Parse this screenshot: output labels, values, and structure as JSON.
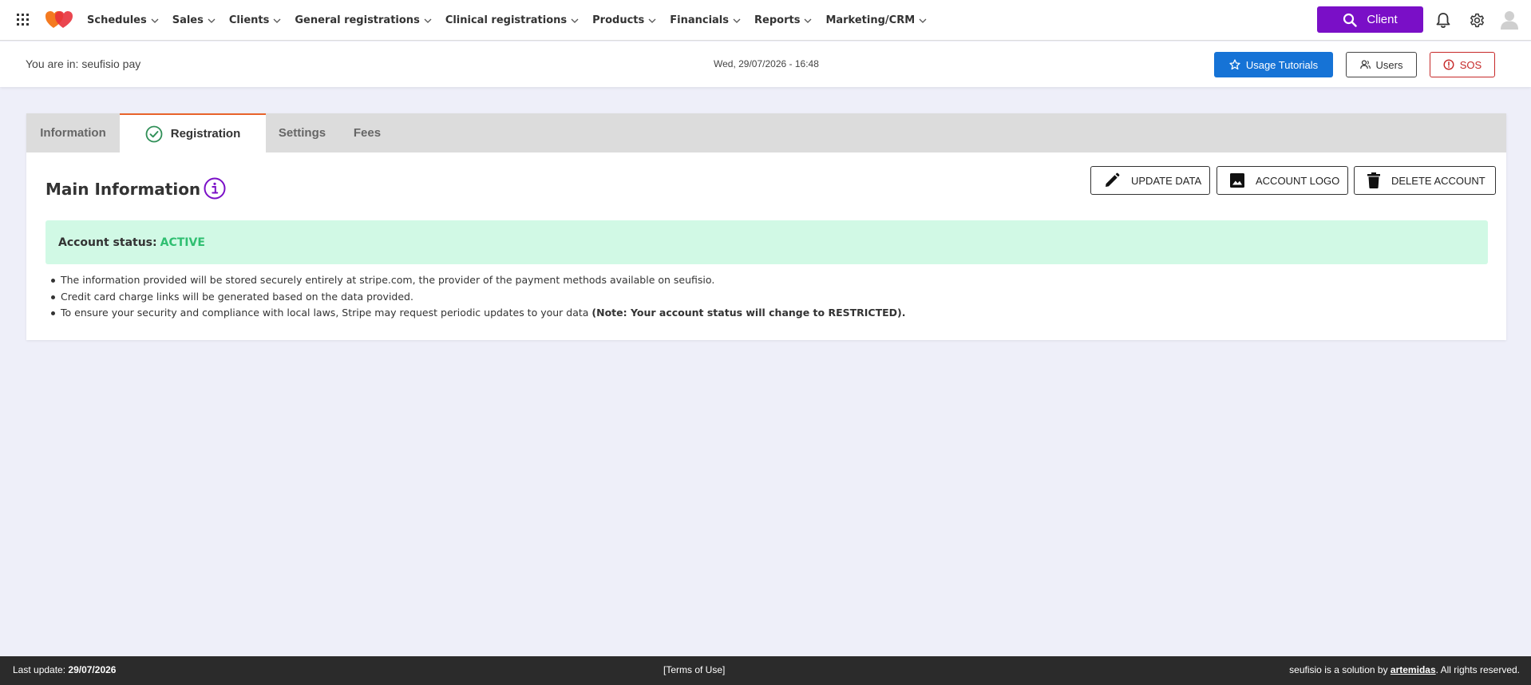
{
  "nav": {
    "items": [
      {
        "label": "Schedules"
      },
      {
        "label": "Sales"
      },
      {
        "label": "Clients"
      },
      {
        "label": "General registrations"
      },
      {
        "label": "Clinical registrations"
      },
      {
        "label": "Products"
      },
      {
        "label": "Financials"
      },
      {
        "label": "Reports"
      },
      {
        "label": "Marketing/CRM"
      }
    ],
    "client_button": "Client"
  },
  "header": {
    "location": "You are in: seufisio pay",
    "datetime": "Wed, 29/07/2026 - 16:48",
    "tutorials_label": "Usage Tutorials",
    "users_label": "Users",
    "sos_label": "SOS"
  },
  "tabs": [
    {
      "label": "Information"
    },
    {
      "label": "Registration"
    },
    {
      "label": "Settings"
    },
    {
      "label": "Fees"
    }
  ],
  "main": {
    "title": "Main Information",
    "actions": {
      "update": "UPDATE DATA",
      "logo": "ACCOUNT LOGO",
      "delete": "DELETE ACCOUNT"
    },
    "status_label": "Account status:",
    "status_value": "ACTIVE",
    "notes": [
      "The information provided will be stored securely entirely at stripe.com, the provider of the payment methods available on seufisio.",
      "Credit card charge links will be generated based on the data provided.",
      "To ensure your security and compliance with local laws, Stripe may request periodic updates to your data"
    ],
    "note_bold": "(Note: Your account status will change to RESTRICTED)."
  },
  "footer": {
    "last_update_label": "Last update:",
    "last_update_value": "29/07/2026",
    "terms": "[Terms of Use]",
    "credit_prefix": "seufisio is a solution by",
    "credit_link": "artemidas",
    "credit_suffix": ". All rights reserved."
  },
  "colors": {
    "brand_purple": "#7a0fc7",
    "primary_blue": "#1673d6",
    "danger_red": "#c62828",
    "status_green": "#2fbf71",
    "active_tab_accent": "#e8632b"
  }
}
